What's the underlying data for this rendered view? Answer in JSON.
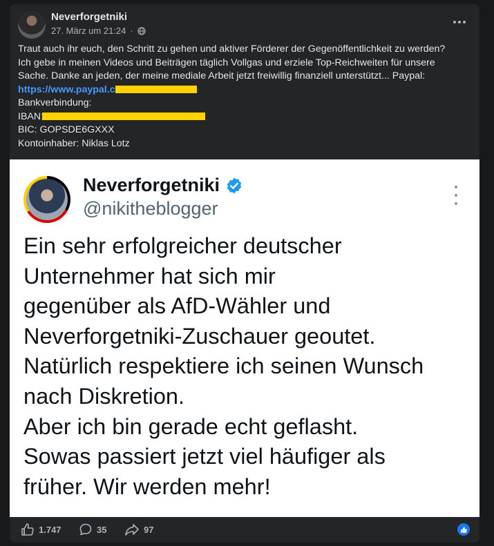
{
  "post": {
    "author": "Neverforgetniki",
    "timestamp": "27. März um 21:24",
    "audience_icon": "globe-icon",
    "more_icon": "more-options-icon",
    "text_lines": [
      "Traut auch ihr euch, den Schritt zu gehen und aktiver Förderer der Gegenöffentlichkeit zu werden?",
      "Ich gebe in meinen Videos und Beiträgen täglich Vollgas und erziele Top-Reichweiten für unsere",
      "Sache. Danke an jeden, der meine mediale Arbeit jetzt freiwillig finanziell unterstützt... Paypal:"
    ],
    "paypal_link": "https://www.paypal.c",
    "bank_label": "Bankverbindung:",
    "iban_label": "IBAN:",
    "bic": "BIC: GOPSDE6GXXX",
    "account_holder": "Kontoinhaber: Niklas Lotz",
    "redaction_color": "#ffd200"
  },
  "tweet": {
    "name": "Neverforgetniki",
    "handle": "@nikitheblogger",
    "verified_icon": "verified-badge-icon",
    "verified_color": "#1d9bf0",
    "body_lines": [
      "Ein sehr erfolgreicher deutscher",
      "Unternehmer hat sich mir",
      "gegenüber als AfD-Wähler und",
      "Neverforgetniki-Zuschauer geoutet.",
      "Natürlich respektiere ich seinen Wunsch",
      "nach Diskretion.",
      "Aber ich bin gerade echt geflasht.",
      "Sowas passiert jetzt viel häufiger als",
      "früher. Wir werden mehr!"
    ]
  },
  "actions": {
    "likes": "1.747",
    "comments": "35",
    "shares": "97",
    "like_icon": "thumbs-up-icon",
    "comment_icon": "comment-icon",
    "share_icon": "share-icon",
    "reaction_icon": "like-reaction-icon",
    "accent_color": "#1877f2"
  }
}
